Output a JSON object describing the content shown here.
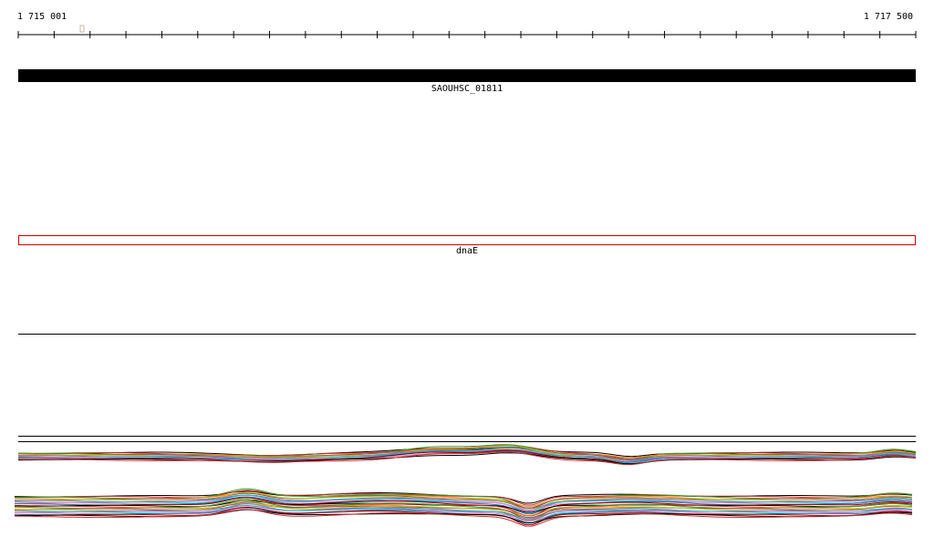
{
  "ruler": {
    "start_label": "1 715 001",
    "end_label": "1 717 500"
  },
  "annotation_track": {
    "gene_label": "SAOUHSC_01811",
    "gene_color": "#000000"
  },
  "feature_track": {
    "feature_label": "dnaE",
    "feature_color": "#d00000"
  },
  "coverage_colors": [
    "#000000",
    "#d62728",
    "#2ca02c",
    "#ff7f0e",
    "#8c564b",
    "#bcbd22",
    "#7f7f7f",
    "#9467bd",
    "#17becf",
    "#e377c2",
    "#1f77b4",
    "#8b0000"
  ]
}
